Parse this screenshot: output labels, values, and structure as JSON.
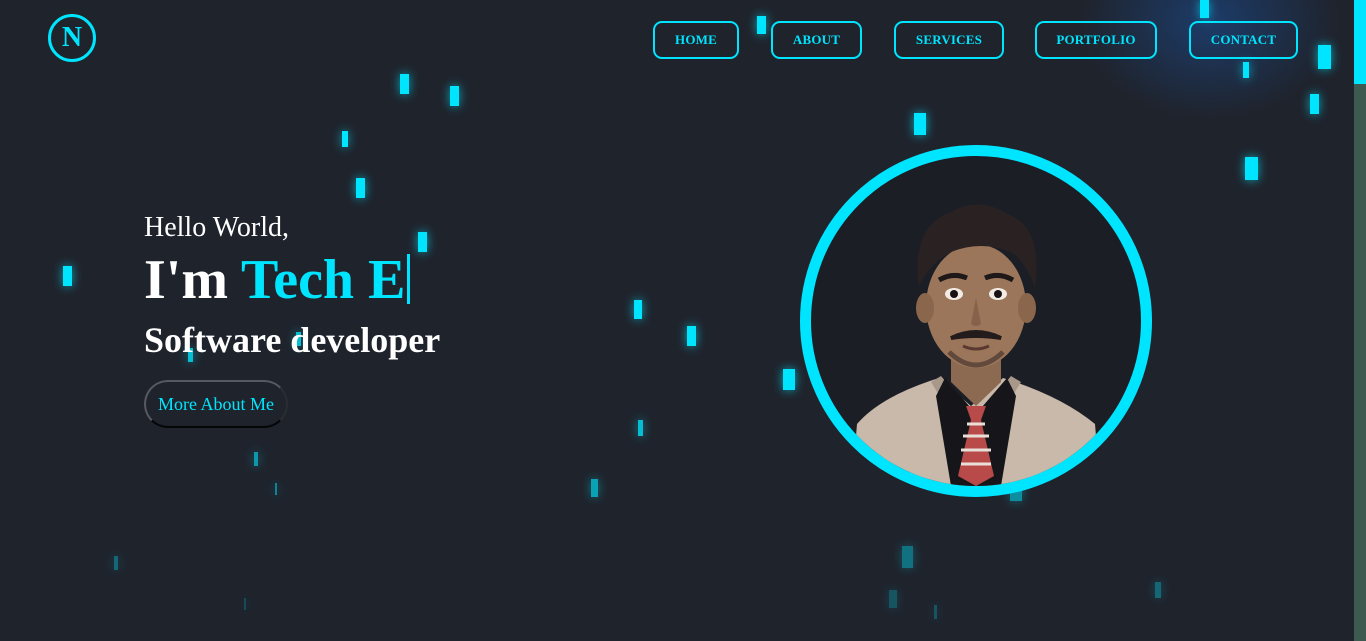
{
  "logo": {
    "letter": "N"
  },
  "nav": {
    "items": [
      "HOME",
      "ABOUT",
      "SERVICES",
      "PORTFOLIO",
      "CONTACT"
    ]
  },
  "hero": {
    "greeting": "Hello World,",
    "intro_prefix": "I'm ",
    "intro_highlight": "Tech E",
    "role": "Software developer",
    "cta_label": "More About Me"
  },
  "icons": {
    "profile": "profile-photo-icon"
  },
  "colors": {
    "background": "#1f232c",
    "accent": "#00e5ff",
    "text": "#ffffff"
  }
}
